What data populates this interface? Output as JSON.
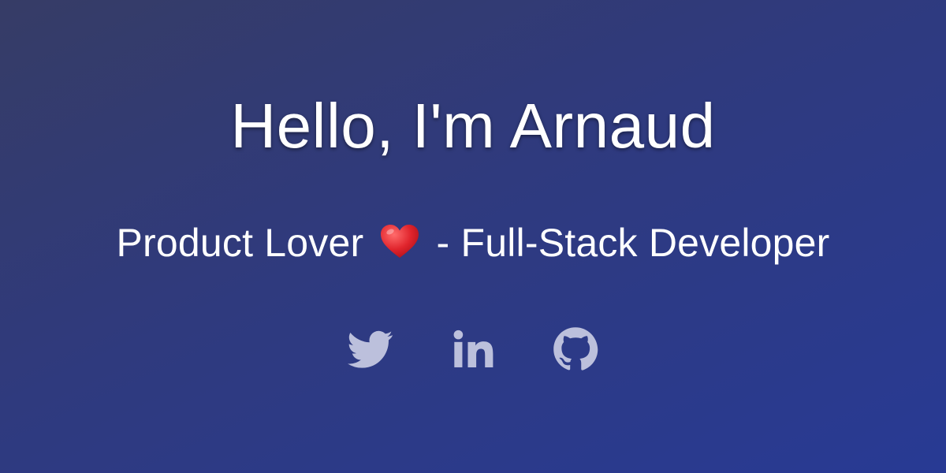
{
  "hero": {
    "title": "Hello, I'm Arnaud",
    "subtitle_left": "Product Lover",
    "subtitle_right": "- Full-Stack Developer"
  },
  "socials": [
    {
      "icon": "twitter-icon"
    },
    {
      "icon": "linkedin-icon"
    },
    {
      "icon": "github-icon"
    }
  ],
  "colors": {
    "background_start": "#363c66",
    "background_end": "#283a94",
    "text": "#ffffff",
    "icon": "#bcc0dc",
    "heart": "#e0242c"
  }
}
